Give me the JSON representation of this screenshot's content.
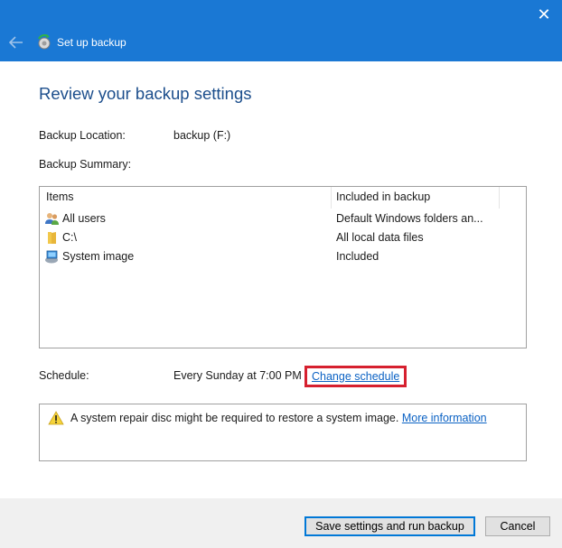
{
  "window": {
    "title": "Set up backup",
    "close_glyph": "✕"
  },
  "page": {
    "heading": "Review your backup settings"
  },
  "backup_location": {
    "label": "Backup Location:",
    "value": "backup (F:)"
  },
  "backup_summary": {
    "label": "Backup Summary:",
    "columns": [
      "Items",
      "Included in backup"
    ],
    "rows": [
      {
        "item": "All users",
        "included": "Default Windows folders an...",
        "icon": "users-icon"
      },
      {
        "item": "C:\\",
        "included": "All local data files",
        "icon": "folder-icon"
      },
      {
        "item": "System image",
        "included": "Included",
        "icon": "system-image-icon"
      }
    ]
  },
  "schedule": {
    "label": "Schedule:",
    "value": "Every Sunday at 7:00 PM",
    "change_link": "Change schedule"
  },
  "warning": {
    "text": "A system repair disc might be required to restore a system image.",
    "link": "More information",
    "icon": "warning-icon"
  },
  "buttons": {
    "save": "Save settings and run backup",
    "cancel": "Cancel"
  },
  "colors": {
    "titlebar": "#1a78d4",
    "heading": "#1c4e8c",
    "link": "#0b62c4",
    "highlight": "#d6202f"
  }
}
